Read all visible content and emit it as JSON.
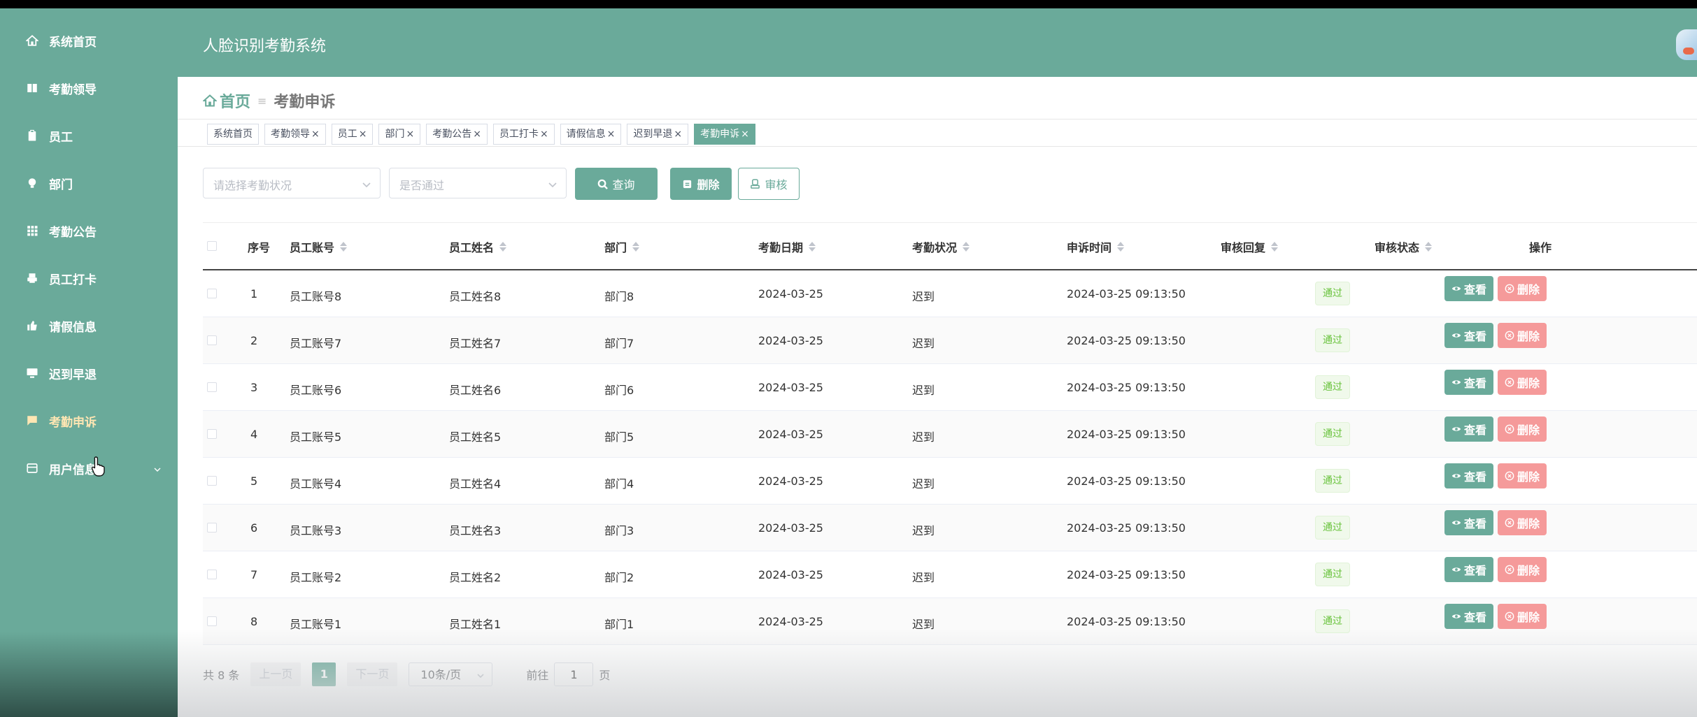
{
  "sidebar": {
    "items": [
      {
        "label": "系统首页",
        "icon": "home-icon"
      },
      {
        "label": "考勤领导",
        "icon": "book-icon"
      },
      {
        "label": "员工",
        "icon": "clipboard-icon"
      },
      {
        "label": "部门",
        "icon": "bulb-icon"
      },
      {
        "label": "考勤公告",
        "icon": "grid-icon"
      },
      {
        "label": "员工打卡",
        "icon": "printer-icon"
      },
      {
        "label": "请假信息",
        "icon": "like-icon"
      },
      {
        "label": "迟到早退",
        "icon": "monitor-icon"
      },
      {
        "label": "考勤申诉",
        "icon": "message-icon",
        "active": true
      },
      {
        "label": "用户信息",
        "icon": "card-icon"
      }
    ]
  },
  "header": {
    "title": "人脸识别考勤系统"
  },
  "breadcrumb": {
    "home": "首页",
    "sep": "≡",
    "current": "考勤申诉"
  },
  "tags": [
    {
      "label": "系统首页",
      "closable": false
    },
    {
      "label": "考勤领导",
      "closable": true
    },
    {
      "label": "员工",
      "closable": true
    },
    {
      "label": "部门",
      "closable": true
    },
    {
      "label": "考勤公告",
      "closable": true
    },
    {
      "label": "员工打卡",
      "closable": true
    },
    {
      "label": "请假信息",
      "closable": true
    },
    {
      "label": "迟到早退",
      "closable": true
    },
    {
      "label": "考勤申诉",
      "closable": true,
      "active": true
    }
  ],
  "filters": {
    "status_placeholder": "请选择考勤状况",
    "pass_placeholder": "是否通过",
    "query_label": "查询",
    "delete_label": "删除",
    "audit_label": "审核"
  },
  "table": {
    "headers": {
      "index": "序号",
      "account": "员工账号",
      "name": "员工姓名",
      "dept": "部门",
      "date": "考勤日期",
      "status": "考勤状况",
      "appeal_time": "申诉时间",
      "reply": "审核回复",
      "review": "审核状态",
      "ops": "操作"
    },
    "view_label": "查看",
    "delete_label": "删除",
    "rows": [
      {
        "index": "1",
        "account": "员工账号8",
        "name": "员工姓名8",
        "dept": "部门8",
        "date": "2024-03-25",
        "status": "迟到",
        "appeal_time": "2024-03-25 09:13:50",
        "reply": "",
        "review": "通过"
      },
      {
        "index": "2",
        "account": "员工账号7",
        "name": "员工姓名7",
        "dept": "部门7",
        "date": "2024-03-25",
        "status": "迟到",
        "appeal_time": "2024-03-25 09:13:50",
        "reply": "",
        "review": "通过"
      },
      {
        "index": "3",
        "account": "员工账号6",
        "name": "员工姓名6",
        "dept": "部门6",
        "date": "2024-03-25",
        "status": "迟到",
        "appeal_time": "2024-03-25 09:13:50",
        "reply": "",
        "review": "通过"
      },
      {
        "index": "4",
        "account": "员工账号5",
        "name": "员工姓名5",
        "dept": "部门5",
        "date": "2024-03-25",
        "status": "迟到",
        "appeal_time": "2024-03-25 09:13:50",
        "reply": "",
        "review": "通过"
      },
      {
        "index": "5",
        "account": "员工账号4",
        "name": "员工姓名4",
        "dept": "部门4",
        "date": "2024-03-25",
        "status": "迟到",
        "appeal_time": "2024-03-25 09:13:50",
        "reply": "",
        "review": "通过"
      },
      {
        "index": "6",
        "account": "员工账号3",
        "name": "员工姓名3",
        "dept": "部门3",
        "date": "2024-03-25",
        "status": "迟到",
        "appeal_time": "2024-03-25 09:13:50",
        "reply": "",
        "review": "通过"
      },
      {
        "index": "7",
        "account": "员工账号2",
        "name": "员工姓名2",
        "dept": "部门2",
        "date": "2024-03-25",
        "status": "迟到",
        "appeal_time": "2024-03-25 09:13:50",
        "reply": "",
        "review": "通过"
      },
      {
        "index": "8",
        "account": "员工账号1",
        "name": "员工姓名1",
        "dept": "部门1",
        "date": "2024-03-25",
        "status": "迟到",
        "appeal_time": "2024-03-25 09:13:50",
        "reply": "",
        "review": "通过"
      }
    ]
  },
  "pager": {
    "total": "共 8 条",
    "prev": "上一页",
    "page": "1",
    "next": "下一页",
    "size": "10条/页",
    "goto_prefix": "前往",
    "goto_value": "1",
    "goto_suffix": "页"
  },
  "colors": {
    "accent": "#6aaa9a",
    "danger_light": "#f59a9a",
    "success": "#67c23a"
  }
}
